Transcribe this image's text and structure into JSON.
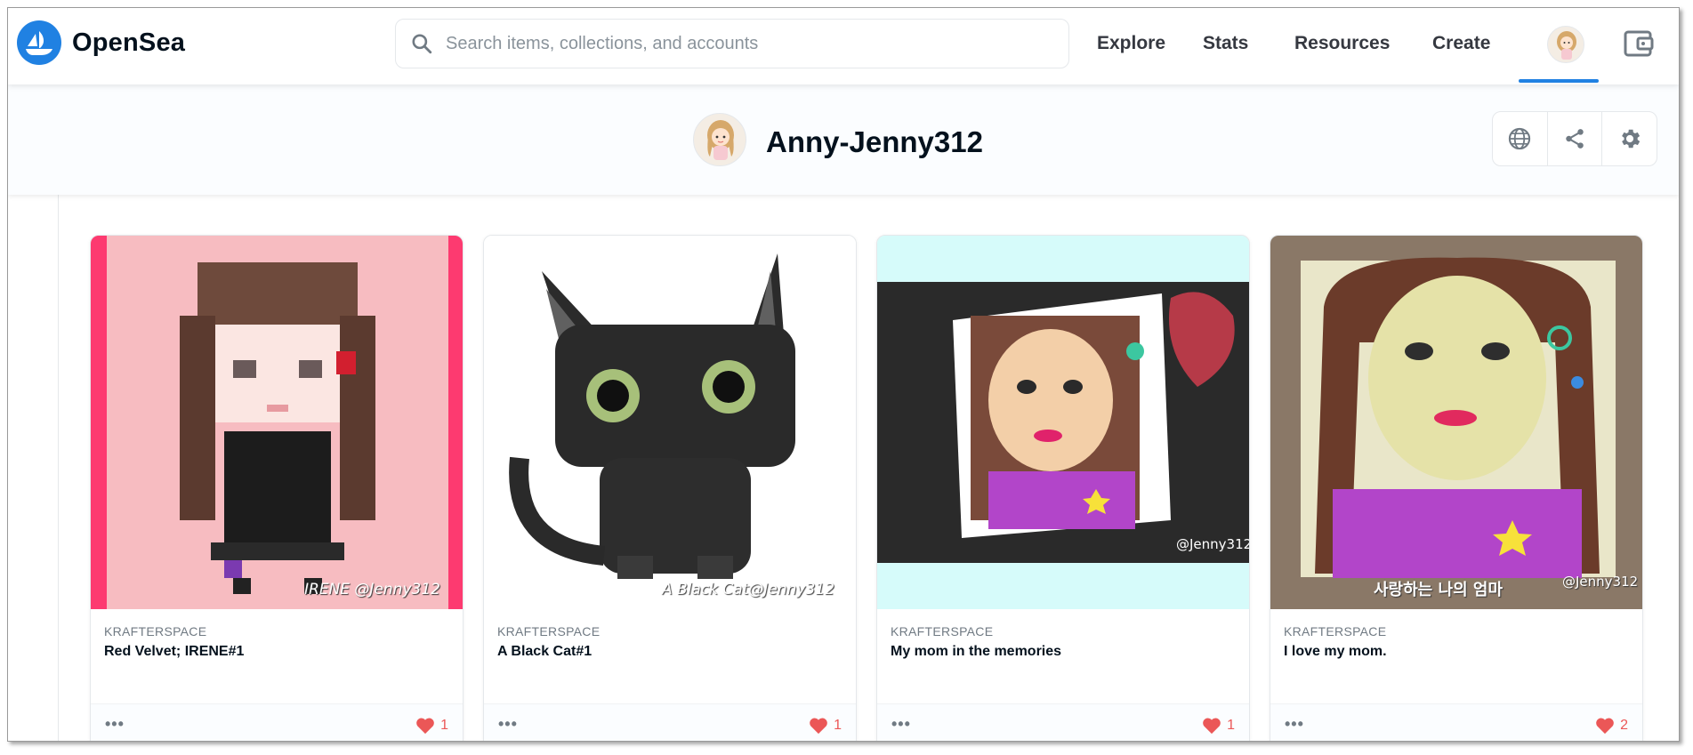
{
  "navbar": {
    "brand": "OpenSea",
    "search_placeholder": "Search items, collections, and accounts",
    "links": [
      "Explore",
      "Stats",
      "Resources",
      "Create"
    ]
  },
  "profile": {
    "name": "Anny-Jenny312"
  },
  "cards": [
    {
      "collection": "KRAFTERSPACE",
      "title": "Red Velvet; IRENE#1",
      "likes": "1",
      "caption": "IRENE @Jenny312"
    },
    {
      "collection": "KRAFTERSPACE",
      "title": "A Black Cat#1",
      "likes": "1",
      "caption": "A Black Cat@Jenny312"
    },
    {
      "collection": "KRAFTERSPACE",
      "title": "My mom in the memories",
      "likes": "1",
      "caption": "@Jenny312"
    },
    {
      "collection": "KRAFTERSPACE",
      "title": "I love my mom.",
      "likes": "2",
      "caption": "@Jenny312",
      "caption_kr": "사랑하는 나의 엄마"
    }
  ],
  "more_label": "•••",
  "colors": {
    "accent": "#2081e2",
    "heart": "#eb5757",
    "text": "#04111d",
    "muted": "#707a83"
  }
}
